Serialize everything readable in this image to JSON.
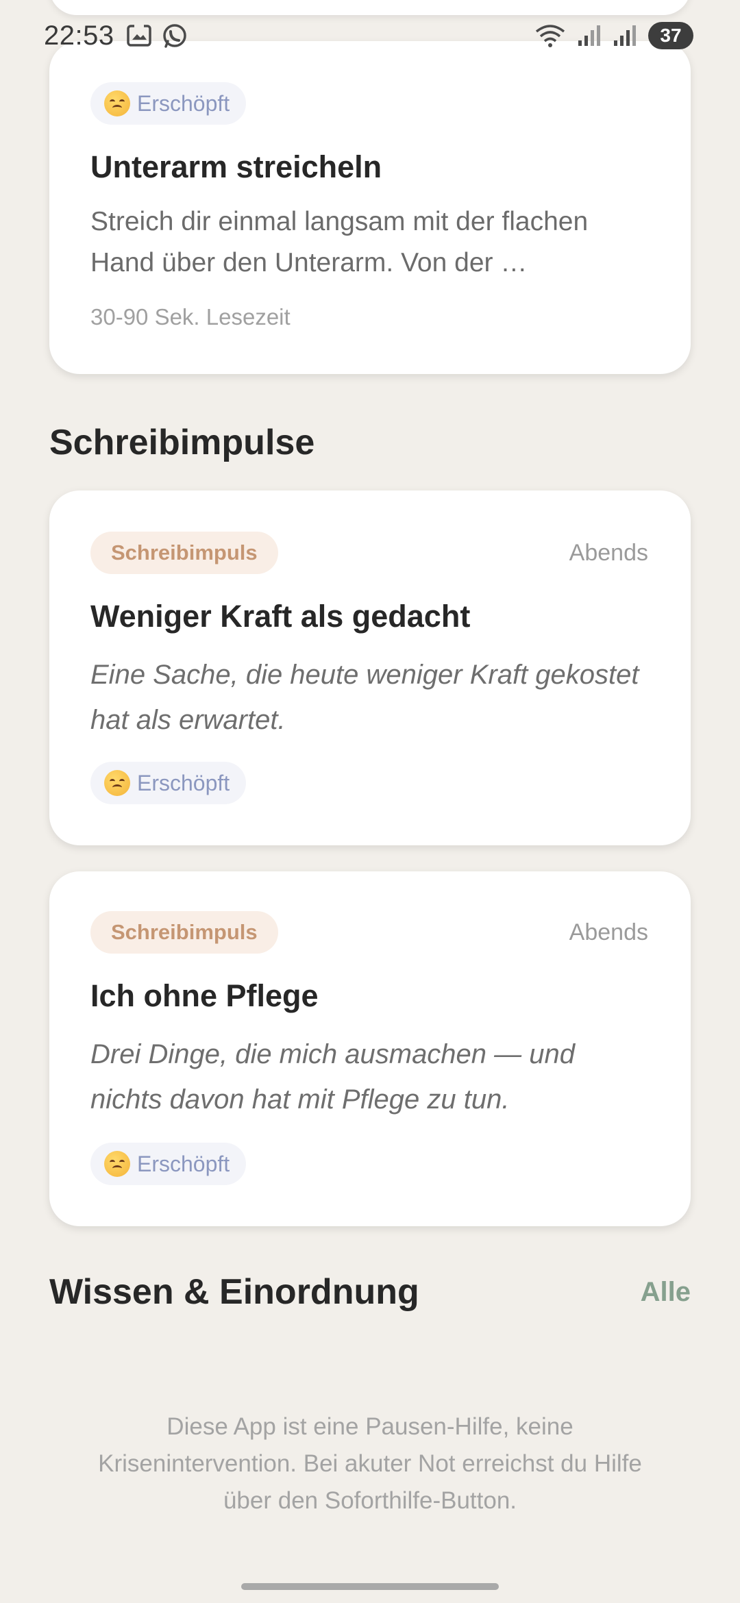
{
  "status_bar": {
    "time": "22:53",
    "battery": "37"
  },
  "top_card": {
    "mood_chip": "Erschöpft",
    "title": "Unterarm streicheln",
    "text": "Streich dir einmal langsam mit der flachen Hand über den Unterarm. Von der …",
    "meta": "30-90 Sek. Lesezeit"
  },
  "schreibimpulse": {
    "section_title": "Schreibimpulse",
    "cards": [
      {
        "chip": "Schreibimpuls",
        "time": "Abends",
        "title": "Weniger Kraft als gedacht",
        "text": "Eine Sache, die heute weniger Kraft gekostet hat als erwartet.",
        "mood_chip": "Erschöpft"
      },
      {
        "chip": "Schreibimpuls",
        "time": "Abends",
        "title": "Ich ohne Pflege",
        "text": "Drei Dinge, die mich ausmachen — und nichts davon hat mit Pflege zu tun.",
        "mood_chip": "Erschöpft"
      }
    ]
  },
  "wissen": {
    "section_title": "Wissen & Einordnung",
    "link": "Alle"
  },
  "disclaimer": "Diese App ist eine Pausen-Hilfe, keine Krisenintervention. Bei akuter Not erreichst du Hilfe über den Soforthilfe-Button.",
  "colors": {
    "background": "#f2efea",
    "mood_chip_text": "#8b97bf",
    "impuls_chip_text": "#c59673",
    "accent_link": "#86a08e"
  },
  "icons": [
    "screenshot-icon",
    "whatsapp-icon",
    "wifi-icon",
    "signal-icon",
    "signal-icon-2",
    "mood-exhausted-emoji"
  ]
}
